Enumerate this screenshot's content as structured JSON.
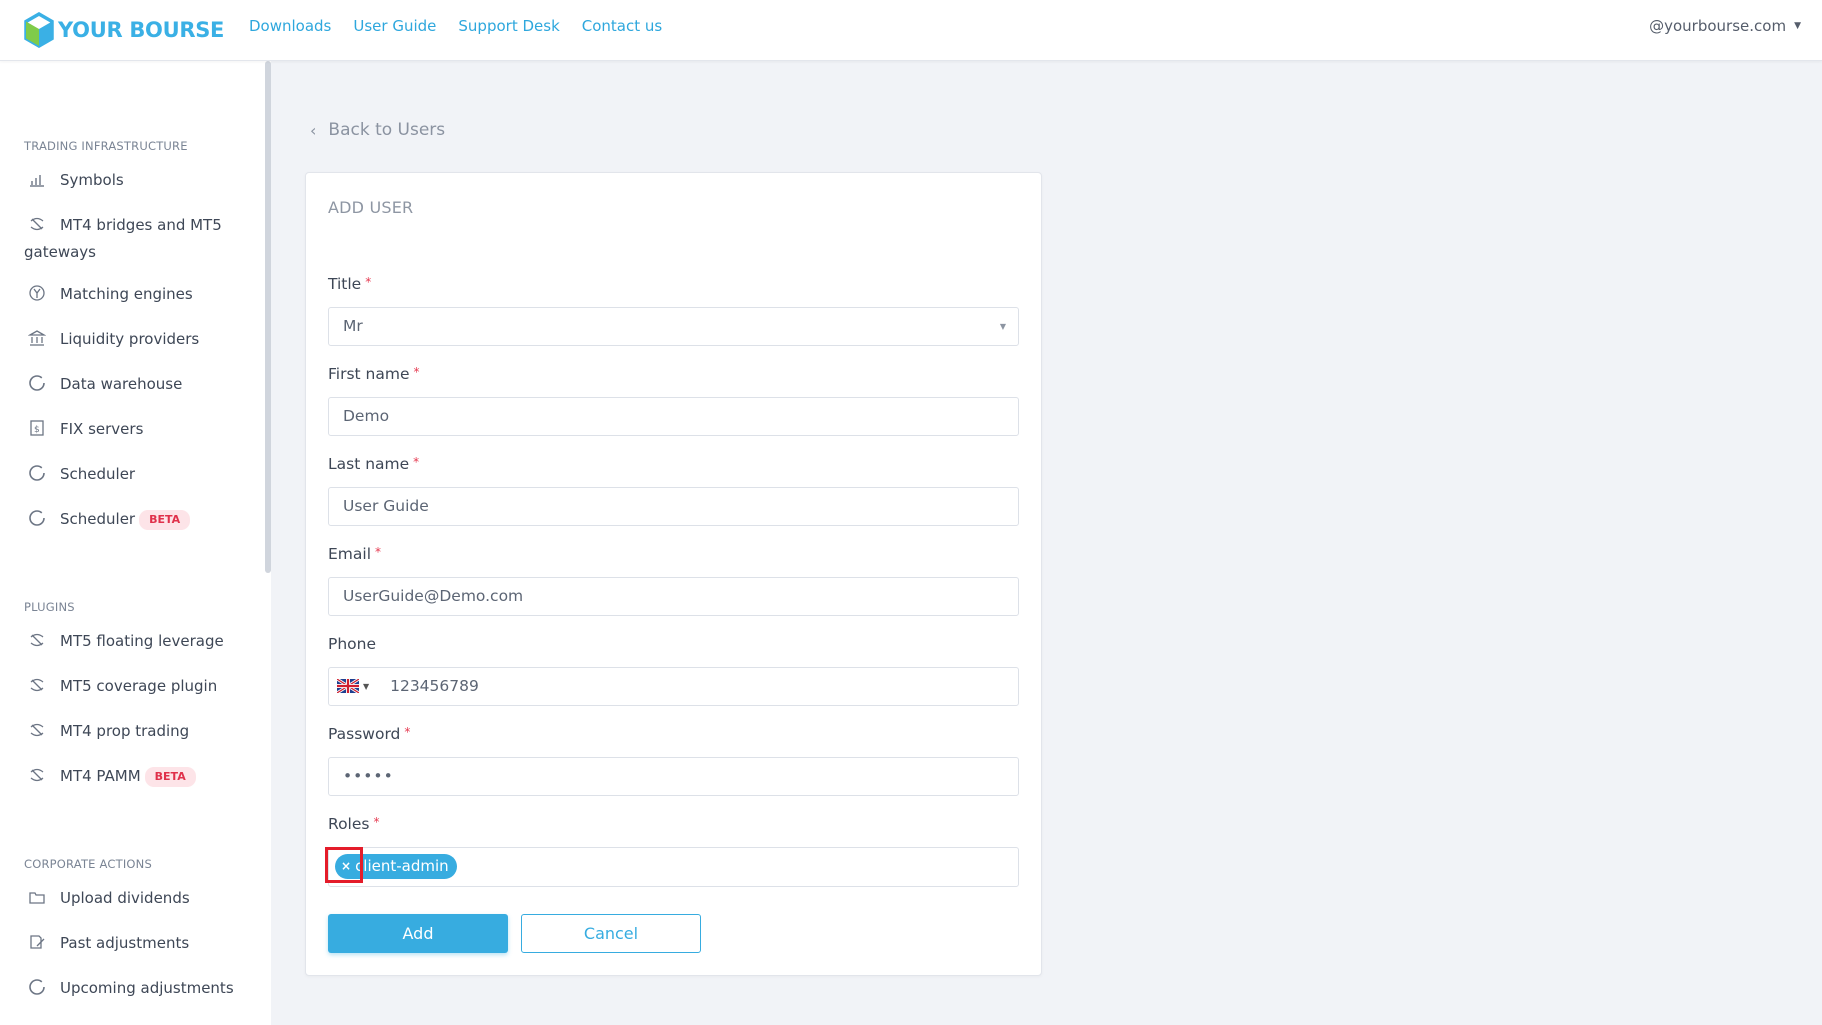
{
  "header": {
    "brand": "YOUR BOURSE",
    "nav": [
      "Downloads",
      "User Guide",
      "Support Desk",
      "Contact us"
    ],
    "account": "@yourbourse.com"
  },
  "sidebar": {
    "sections": [
      {
        "title": "TRADING INFRASTRUCTURE",
        "items": [
          {
            "label": "Symbols",
            "icon": "bar-chart-icon"
          },
          {
            "label": "MT4 bridges and MT5 gateways",
            "icon": "bridge-icon"
          },
          {
            "label": "Matching engines",
            "icon": "engine-icon"
          },
          {
            "label": "Liquidity providers",
            "icon": "bank-icon"
          },
          {
            "label": "Data warehouse",
            "icon": "circle-icon"
          },
          {
            "label": "FIX servers",
            "icon": "document-icon"
          },
          {
            "label": "Scheduler",
            "icon": "circle-icon"
          },
          {
            "label": "Scheduler",
            "icon": "circle-icon",
            "badge": "BETA"
          }
        ]
      },
      {
        "title": "PLUGINS",
        "items": [
          {
            "label": "MT5 floating leverage",
            "icon": "bridge-icon"
          },
          {
            "label": "MT5 coverage plugin",
            "icon": "bridge-icon"
          },
          {
            "label": "MT4 prop trading",
            "icon": "bridge-icon"
          },
          {
            "label": "MT4 PAMM",
            "icon": "bridge-icon",
            "badge": "BETA"
          }
        ]
      },
      {
        "title": "CORPORATE ACTIONS",
        "items": [
          {
            "label": "Upload dividends",
            "icon": "folder-icon"
          },
          {
            "label": "Past adjustments",
            "icon": "edit-icon"
          },
          {
            "label": "Upcoming adjustments",
            "icon": "circle-icon"
          }
        ]
      }
    ]
  },
  "main": {
    "back_label": "Back to Users",
    "card_title": "ADD USER",
    "fields": {
      "title": {
        "label": "Title",
        "value": "Mr"
      },
      "first_name": {
        "label": "First name",
        "value": "Demo"
      },
      "last_name": {
        "label": "Last name",
        "value": "User Guide"
      },
      "email": {
        "label": "Email",
        "value": "UserGuide@Demo.com"
      },
      "phone": {
        "label": "Phone",
        "value": "123456789"
      },
      "password": {
        "label": "Password",
        "value": "•••••"
      },
      "roles": {
        "label": "Roles",
        "tags": [
          "client-admin"
        ]
      }
    },
    "required_mark": "*",
    "add_label": "Add",
    "cancel_label": "Cancel"
  },
  "colors": {
    "accent": "#37ace0",
    "required": "#e53950",
    "highlight": "#e41c2a"
  }
}
